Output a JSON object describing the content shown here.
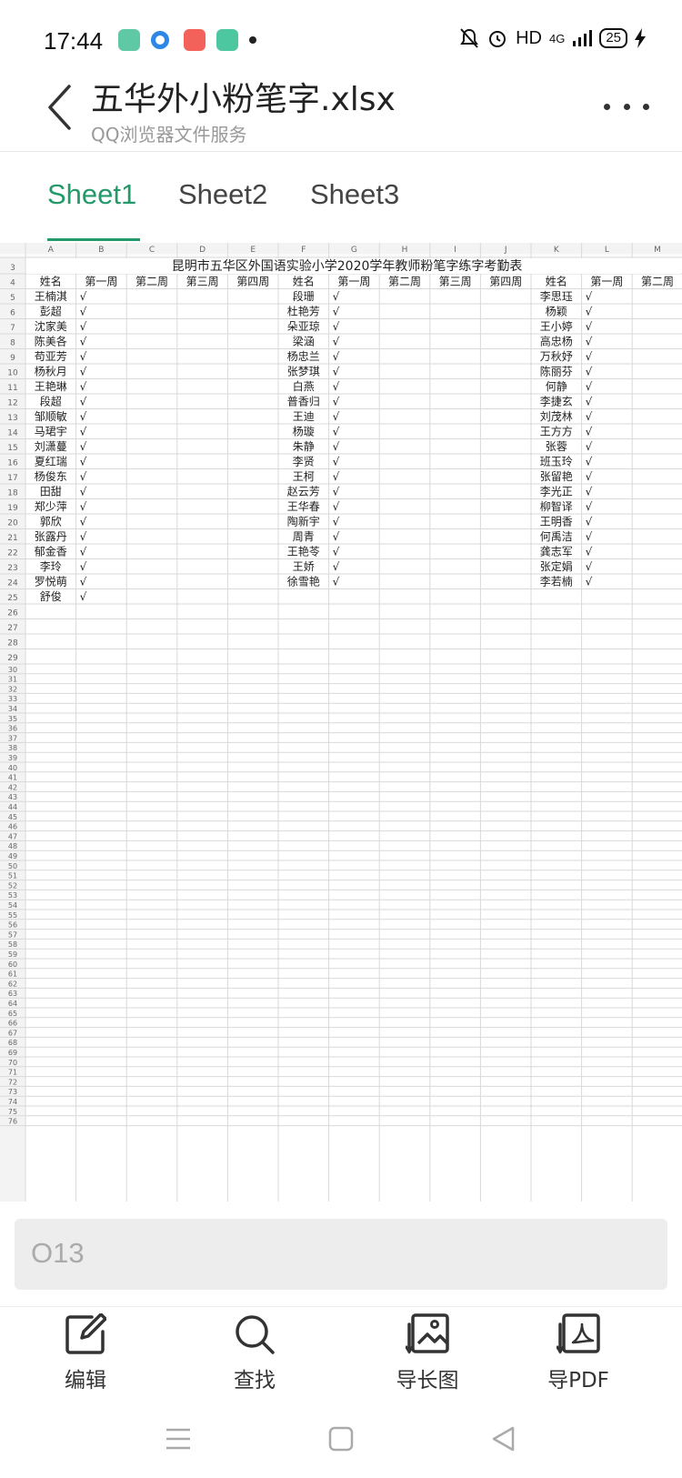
{
  "status_bar": {
    "time": "17:44",
    "network": "HD",
    "signal": "4G",
    "battery": "25",
    "app_icons": [
      {
        "name": "messages-app-icon",
        "color": "#5fc9a6"
      },
      {
        "name": "browser-app-icon",
        "color": "#2e87e6"
      },
      {
        "name": "gallery-app-icon",
        "color": "#f2625a"
      },
      {
        "name": "book-app-icon",
        "color": "#4cc7a0"
      }
    ]
  },
  "header": {
    "title": "五华外小粉笔字.xlsx",
    "subtitle": "QQ浏览器文件服务"
  },
  "tabs": [
    {
      "label": "Sheet1",
      "active": true
    },
    {
      "label": "Sheet2",
      "active": false
    },
    {
      "label": "Sheet3",
      "active": false
    }
  ],
  "sheet": {
    "column_letters": [
      "A",
      "B",
      "C",
      "D",
      "E",
      "F",
      "G",
      "H",
      "I",
      "J",
      "K",
      "L",
      "M"
    ],
    "title": "昆明市五华区外国语实验小学2020学年教师粉笔字练字考勤表",
    "headers": [
      "姓名",
      "第一周",
      "第二周",
      "第三周",
      "第四周",
      "姓名",
      "第一周",
      "第二周",
      "第三周",
      "第四周",
      "姓名",
      "第一周",
      "第二周"
    ],
    "check": "√",
    "names_group1": [
      "王楠淇",
      "彭超",
      "沈家美",
      "陈美各",
      "苟亚芳",
      "杨秋月",
      "王艳琳",
      "段超",
      "邹顺敏",
      "马珺宇",
      "刘潇蔓",
      "夏红瑞",
      "杨俊东",
      "田甜",
      "郑少萍",
      "郭欣",
      "张露丹",
      "郁金香",
      "李玲",
      "罗悦萌",
      "舒俊"
    ],
    "names_group2": [
      "段珊",
      "杜艳芳",
      "朵亚琼",
      "梁涵",
      "杨忠兰",
      "张梦琪",
      "白燕",
      "普香归",
      "王迪",
      "杨璇",
      "朱静",
      "李贤",
      "王柯",
      "赵云芳",
      "王华春",
      "陶新宇",
      "周青",
      "王艳苓",
      "王娇",
      "徐雪艳"
    ],
    "names_group3": [
      "李思珏",
      "杨颖",
      "王小婷",
      "高忠杨",
      "万秋妤",
      "陈丽芬",
      "何静",
      "李捷玄",
      "刘茂林",
      "王方方",
      "张蓉",
      "班玉玲",
      "张留艳",
      "李光正",
      "柳智译",
      "王明香",
      "何禹洁",
      "龚志军",
      "张定娟",
      "李若楠"
    ],
    "checks_group1": [
      true,
      true,
      true,
      true,
      true,
      true,
      true,
      true,
      true,
      true,
      true,
      true,
      true,
      true,
      true,
      true,
      true,
      true,
      true,
      true,
      true
    ],
    "checks_group2": [
      true,
      true,
      true,
      true,
      true,
      true,
      true,
      true,
      true,
      true,
      true,
      true,
      true,
      true,
      true,
      true,
      true,
      true,
      true,
      true
    ],
    "checks_group3": [
      true,
      true,
      true,
      true,
      true,
      true,
      true,
      true,
      true,
      true,
      true,
      true,
      true,
      true,
      true,
      true,
      true,
      true,
      true,
      true
    ],
    "row_numbers": [
      "3",
      "4",
      "5",
      "6",
      "7",
      "8",
      "9",
      "10",
      "11",
      "12",
      "13",
      "14",
      "15",
      "16",
      "17",
      "18",
      "19",
      "20",
      "21",
      "22",
      "23",
      "24",
      "25",
      "26",
      "27",
      "28",
      "29",
      "30",
      "31",
      "32",
      "33",
      "34",
      "35",
      "36",
      "37",
      "38",
      "39",
      "40",
      "41",
      "42",
      "43",
      "44",
      "45",
      "46",
      "47",
      "48",
      "49",
      "50",
      "51",
      "52",
      "53",
      "54",
      "55",
      "56",
      "57",
      "58",
      "59",
      "60",
      "61",
      "62",
      "63",
      "64",
      "65",
      "66",
      "67",
      "68",
      "69",
      "70",
      "71",
      "72",
      "73",
      "74",
      "75",
      "76"
    ]
  },
  "cell_bar": {
    "value": "O13"
  },
  "toolbar": [
    {
      "label": "编辑",
      "icon": "edit-icon"
    },
    {
      "label": "查找",
      "icon": "search-icon"
    },
    {
      "label": "导长图",
      "icon": "long-image-icon"
    },
    {
      "label": "导PDF",
      "icon": "pdf-icon"
    }
  ],
  "nav_bar": {
    "icons": [
      "menu-icon",
      "home-icon",
      "back-icon"
    ]
  },
  "colors": {
    "accent": "#24996a",
    "grid": "#d9d9d9",
    "header_bg": "#f3f3f3"
  }
}
